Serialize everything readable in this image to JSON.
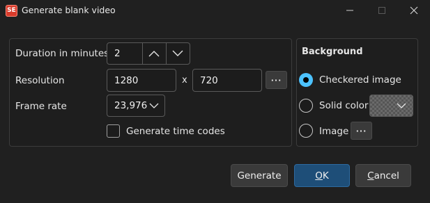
{
  "window": {
    "title": "Generate blank video",
    "app_icon_text": "SE"
  },
  "duration": {
    "label": "Duration in minutes",
    "value": "2"
  },
  "resolution": {
    "label": "Resolution",
    "width": "1280",
    "separator": "x",
    "height": "720",
    "browse_label": "···"
  },
  "frame_rate": {
    "label": "Frame rate",
    "value": "23,976"
  },
  "time_codes": {
    "label": "Generate time codes",
    "checked": false
  },
  "background": {
    "title": "Background",
    "options": [
      {
        "label": "Checkered image",
        "selected": true
      },
      {
        "label": "Solid color",
        "selected": false
      },
      {
        "label": "Image",
        "selected": false
      }
    ],
    "image_browse_label": "···"
  },
  "buttons": {
    "generate": "Generate",
    "ok": {
      "accel": "O",
      "rest": "K"
    },
    "cancel": {
      "accel": "C",
      "rest": "ancel"
    }
  },
  "colors": {
    "accent": "#4cc2ff",
    "ok_button": "#1e4e78"
  }
}
